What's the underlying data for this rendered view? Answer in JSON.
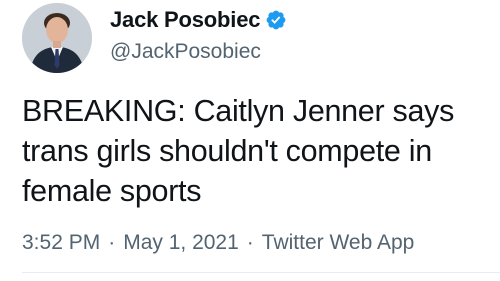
{
  "author": {
    "display_name": "Jack Posobiec",
    "handle": "@JackPosobiec",
    "verified": true,
    "avatar_icon": "profile-photo",
    "verified_icon": "verified-badge-icon",
    "verified_color": "#1d9bf0"
  },
  "tweet": {
    "text": "BREAKING: Caitlyn Jenner says trans girls shouldn't compete in female sports"
  },
  "meta": {
    "time": "3:52 PM",
    "separator_1": "·",
    "date": "May 1, 2021",
    "separator_2": "·",
    "source": "Twitter Web App"
  },
  "colors": {
    "text": "#0f1419",
    "secondary_text": "#536471",
    "background": "#ffffff"
  }
}
